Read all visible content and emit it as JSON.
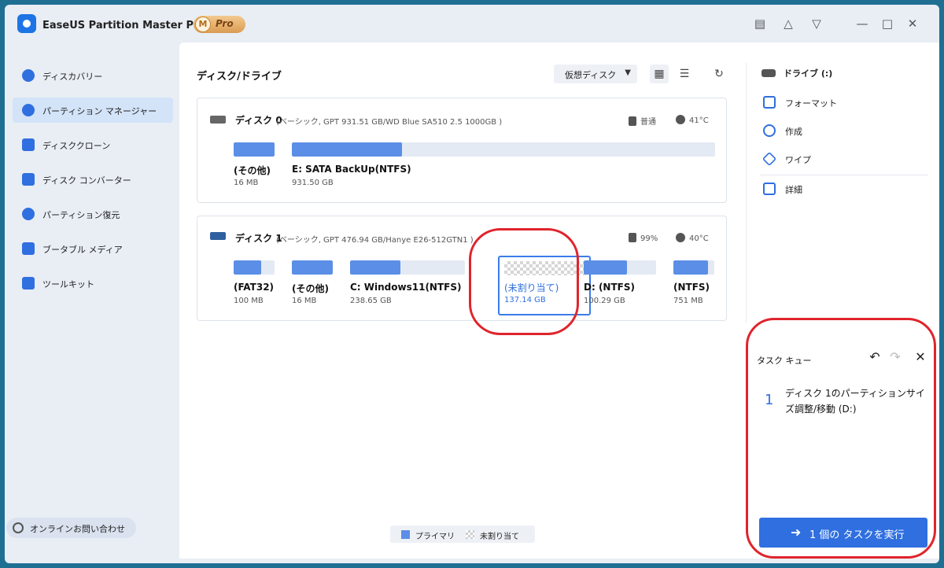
{
  "app": {
    "title": "EaseUS Partition Master Pro版",
    "badge_m": "M",
    "badge_pro": "Pro"
  },
  "titlebar_icons": [
    "notes-icon",
    "shirt-icon",
    "menu-box-icon",
    "minimize-icon",
    "maximize-icon",
    "close-icon"
  ],
  "sidebar": {
    "items": [
      {
        "label": "ディスカバリー",
        "icon": "compass-icon",
        "active": false
      },
      {
        "label": "パーティション マネージャー",
        "icon": "pie-chart-icon",
        "active": true
      },
      {
        "label": "ディスククローン",
        "icon": "clone-icon",
        "active": false
      },
      {
        "label": "ディスク コンバーター",
        "icon": "convert-icon",
        "active": false
      },
      {
        "label": "パーティション復元",
        "icon": "restore-icon",
        "active": false
      },
      {
        "label": "ブータブル メディア",
        "icon": "usb-icon",
        "active": false
      },
      {
        "label": "ツールキット",
        "icon": "toolkit-icon",
        "active": false
      }
    ],
    "contact": "オンラインお問い合わせ"
  },
  "main": {
    "title": "ディスク/ドライブ",
    "virtual_disk": "仮想ディスク",
    "legend": {
      "primary": "プライマリ",
      "unallocated": "未割り当て"
    }
  },
  "disks": [
    {
      "name": "ディスク 0",
      "info": "(ベーシック, GPT 931.51 GB/WD Blue SA510 2.5 1000GB )",
      "health": "普通",
      "temp": "41°C",
      "partitions": [
        {
          "label": "(その他)",
          "size": "16 MB",
          "used_fraction": 1.0
        },
        {
          "label": "E: SATA BackUp(NTFS)",
          "size": "931.50 GB",
          "used_fraction": 0.26
        }
      ]
    },
    {
      "name": "ディスク 1",
      "info": "(ベーシック, GPT 476.94 GB/Hanye E26-512GTN1 )",
      "health": "99%",
      "temp": "40°C",
      "partitions": [
        {
          "label": "(FAT32)",
          "size": "100 MB",
          "used_fraction": 0.68
        },
        {
          "label": "(その他)",
          "size": "16 MB",
          "used_fraction": 1.0
        },
        {
          "label": "C: Windows11(NTFS)",
          "size": "238.65 GB",
          "used_fraction": 0.44
        },
        {
          "label": "(未割り当て)",
          "size": "137.14 GB",
          "unallocated": true
        },
        {
          "label": "D: (NTFS)",
          "size": "100.29 GB",
          "used_fraction": 0.6
        },
        {
          "label": "(NTFS)",
          "size": "751 MB",
          "used_fraction": 0.85
        }
      ]
    }
  ],
  "operations": {
    "drive": "ドライブ (:)",
    "items": [
      {
        "label": "フォーマット",
        "icon": "format-icon"
      },
      {
        "label": "作成",
        "icon": "create-icon"
      },
      {
        "label": "ワイプ",
        "icon": "wipe-icon"
      },
      {
        "label": "詳細",
        "icon": "details-icon"
      }
    ]
  },
  "task_queue": {
    "title": "タスク キュー",
    "tasks": [
      {
        "num": "1",
        "text": "ディスク 1のパーティションサイズ調整/移動 (D:)"
      }
    ],
    "execute": "1 個の タスクを実行"
  },
  "colors": {
    "accent": "#2f6fe0",
    "partition_fill": "#5b8ee6",
    "highlight_ring": "#e0242c",
    "background": "#1f6f93"
  }
}
